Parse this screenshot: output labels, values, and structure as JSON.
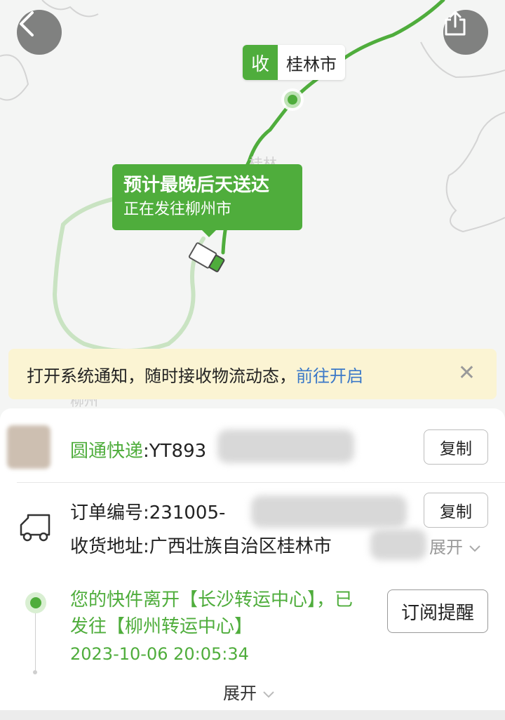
{
  "map": {
    "destination": {
      "icon_label": "收",
      "city": "桂林市"
    },
    "eta": {
      "title": "预计最晚后天送达",
      "subtitle": "正在发往柳州市"
    },
    "labels": {
      "guilin_faded": "桂林",
      "liuzhou_faded": "柳州"
    },
    "colors": {
      "route": "#4fad3c",
      "route_faded": "#c9e3c2",
      "accent": "#4fad3c"
    }
  },
  "top_buttons": {
    "back_icon": "chevron-left-icon",
    "share_icon": "share-icon"
  },
  "notification": {
    "text": "打开系统通知，随时接收物流动态，",
    "link": "前往开启",
    "close": "✕"
  },
  "courier": {
    "name": "圆通快递",
    "separator": ":",
    "tracking_visible": "YT893",
    "copy_label": "复制"
  },
  "order": {
    "number_label": "订单编号:",
    "number_visible": "231005-",
    "copy_label": "复制",
    "address_label": "收货地址:",
    "address_visible": "广西壮族自治区桂林市",
    "expand_label": "展开"
  },
  "tracking": {
    "latest_event": "您的快件离开【长沙转运中心】，已发往【柳州转运中心】",
    "timestamp": "2023-10-06 20:05:34",
    "subscribe_label": "订阅提醒",
    "expand_label": "展开"
  }
}
